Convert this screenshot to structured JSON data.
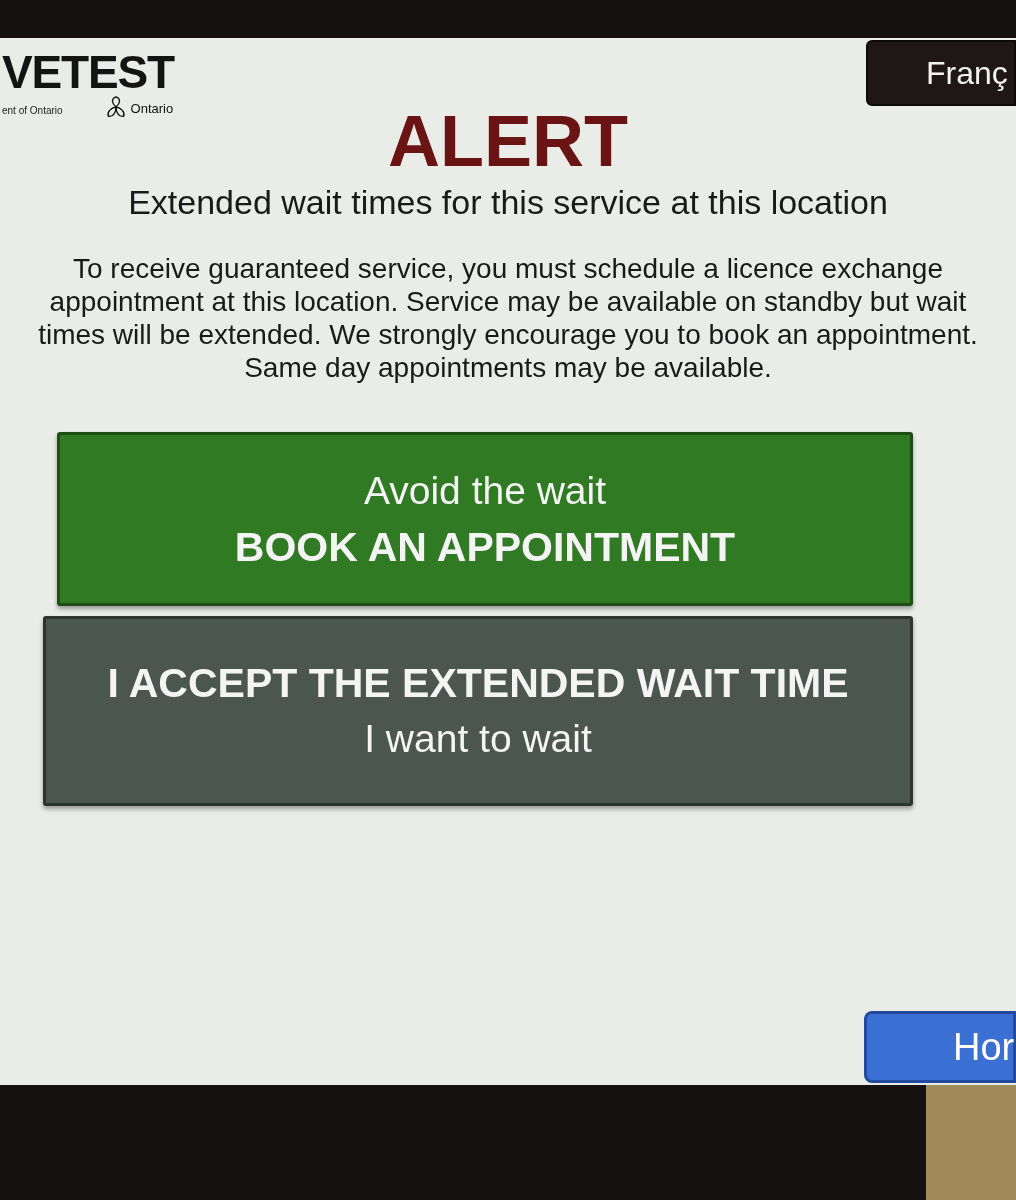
{
  "header": {
    "logo": {
      "wordmark": "VETEST",
      "caption": "ent of Ontario",
      "province": "Ontario"
    },
    "language_button": "Franç"
  },
  "alert": {
    "title": "ALERT",
    "subtitle": "Extended wait times for this service at this location",
    "message": "To receive guaranteed service, you must schedule a licence exchange appointment at this location. Service may be available on standby but wait times will be extended. We strongly encourage you to book an appointment. Same day appointments may be available."
  },
  "actions": [
    {
      "kind": "primary",
      "lines": [
        {
          "kind": "plain",
          "text": "Avoid the wait"
        },
        {
          "kind": "heading",
          "text": "BOOK AN APPOINTMENT"
        }
      ]
    },
    {
      "kind": "secondary",
      "lines": [
        {
          "kind": "heading",
          "text": "I ACCEPT THE EXTENDED WAIT TIME"
        },
        {
          "kind": "plain",
          "text": "I want to wait"
        }
      ]
    }
  ],
  "home_button": "Hor"
}
